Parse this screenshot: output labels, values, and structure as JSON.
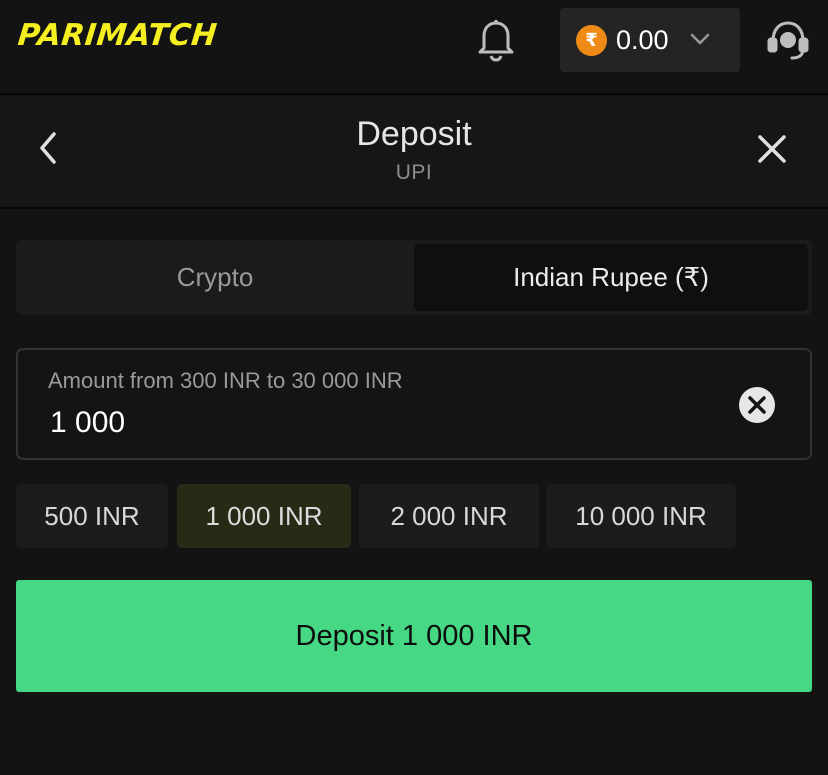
{
  "header": {
    "logo": "PARIMATCH",
    "balance": {
      "currency_symbol": "₹",
      "value": "0.00"
    },
    "icons": {
      "notifications": "bell-icon",
      "dropdown": "chevron-down-icon",
      "support": "headset-icon"
    }
  },
  "page": {
    "title": "Deposit",
    "subtitle": "UPI",
    "back_icon": "chevron-left-icon",
    "close_icon": "close-icon"
  },
  "currency_tabs": [
    {
      "label": "Crypto",
      "selected": false
    },
    {
      "label": "Indian Rupee (₹)",
      "selected": true
    }
  ],
  "amount": {
    "label": "Amount from 300 INR to 30 000 INR",
    "value": "1 000",
    "clear_icon": "clear-circle-icon"
  },
  "quick_amounts": [
    {
      "label": "500 INR",
      "selected": false
    },
    {
      "label": "1 000 INR",
      "selected": true
    },
    {
      "label": "2 000 INR",
      "selected": false
    },
    {
      "label": "10 000 INR",
      "selected": false
    }
  ],
  "deposit_button": {
    "label": "Deposit 1 000 INR"
  },
  "colors": {
    "background": "#131313",
    "brand_yellow": "#f5ef21",
    "coin_orange": "#f08a16",
    "primary_green": "#46d884",
    "selected_chip": "#272a14"
  }
}
